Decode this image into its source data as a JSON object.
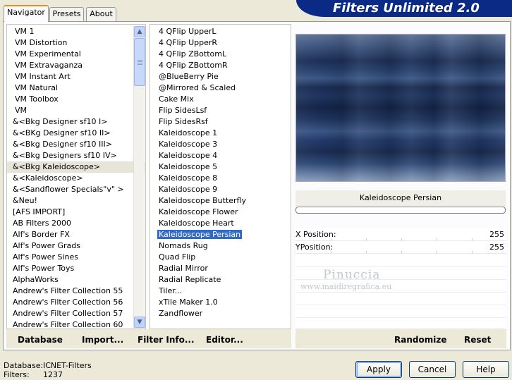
{
  "title": "Filters Unlimited 2.0",
  "tabs": [
    {
      "label": "Navigator",
      "active": true
    },
    {
      "label": "Presets",
      "active": false
    },
    {
      "label": "About",
      "active": false
    }
  ],
  "categories": [
    "VM 1",
    "VM Distortion",
    "VM Experimental",
    "VM Extravaganza",
    "VM Instant Art",
    "VM Natural",
    "VM Toolbox",
    "VM",
    "&<Bkg Designer sf10 I>",
    "&<BKg Designer sf10 II>",
    "&<Bkg Designer sf10 III>",
    "&<Bkg Designers sf10 IV>",
    "&<Bkg Kaleidoscope>",
    "&<Kaleidoscope>",
    "&<Sandflower Specials\"v\" >",
    "&Neu!",
    "[AFS IMPORT]",
    "AB Filters 2000",
    "Alf's Border FX",
    "Alf's Power Grads",
    "Alf's Power Sines",
    "Alf's Power Toys",
    "AlphaWorks",
    "Andrew's Filter Collection 55",
    "Andrew's Filter Collection 56",
    "Andrew's Filter Collection 57",
    "Andrew's Filter Collection 60"
  ],
  "selected_category_index": 12,
  "filters": [
    "4 QFlip UpperL",
    "4 QFlip UpperR",
    "4 QFlip ZBottomL",
    "4 QFlip ZBottomR",
    "@BlueBerry Pie",
    "@Mirrored & Scaled",
    "Cake Mix",
    "Flip SidesLsf",
    "Flip SidesRsf",
    "Kaleidoscope 1",
    "Kaleidoscope 3",
    "Kaleidoscope 4",
    "Kaleidoscope 5",
    "Kaleidoscope 8",
    "Kaleidoscope 9",
    "Kaleidoscope Butterfly",
    "Kaleidoscope Flower",
    "Kaleidoscope Heart",
    "Kaleidoscope Persian",
    "Nomads Rug",
    "Quad Flip",
    "Radial Mirror",
    "Radial Replicate",
    "Tiler...",
    "xTile Maker 1.0",
    "Zandflower"
  ],
  "selected_filter_index": 18,
  "preview": {
    "filter_name": "Kaleidoscope Persian",
    "params": [
      {
        "label": "X Position:",
        "value": "255"
      },
      {
        "label": "YPosition:",
        "value": "255"
      }
    ],
    "watermark_name": "Pinuccia",
    "watermark_url": "www.maidiregrafica.eu"
  },
  "left_bar": {
    "database": "Database",
    "import": "Import...",
    "filter_info": "Filter Info...",
    "editor": "Editor..."
  },
  "right_bar": {
    "randomize": "Randomize",
    "reset": "Reset"
  },
  "status": {
    "database_label": "Database:",
    "database_value": "ICNET-Filters",
    "filters_label": "Filters:",
    "filters_value": "1237"
  },
  "buttons": {
    "apply": "Apply",
    "cancel": "Cancel",
    "help": "Help"
  },
  "colors": {
    "banner": "#0a2a86",
    "selection": "#316ac5",
    "tab_accent": "#e68b2c"
  }
}
